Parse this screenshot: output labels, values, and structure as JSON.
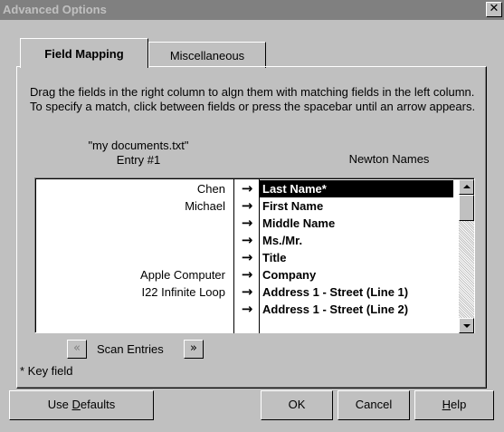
{
  "window": {
    "title": "Advanced Options",
    "close_glyph": "✕"
  },
  "tabs": [
    {
      "label": "Field Mapping",
      "active": true
    },
    {
      "label": "Miscellaneous",
      "active": false
    }
  ],
  "instructions": "Drag the fields in the right column to algn them with matching fields in the left column.  To specify a match, click between fields or press the spacebar until an arrow appears.",
  "source": {
    "file": "\"my documents.txt\"",
    "entry": "Entry #1"
  },
  "destination_header": "Newton Names",
  "arrow_glyph": "→",
  "rows": [
    {
      "source": "Chen",
      "dest": "Last Name*",
      "selected": true
    },
    {
      "source": "Michael",
      "dest": "First Name",
      "selected": false
    },
    {
      "source": "",
      "dest": "Middle Name",
      "selected": false
    },
    {
      "source": "",
      "dest": "Ms./Mr.",
      "selected": false
    },
    {
      "source": "",
      "dest": "Title",
      "selected": false
    },
    {
      "source": "Apple Computer",
      "dest": "Company",
      "selected": false
    },
    {
      "source": "I22 Infinite Loop",
      "dest": "Address 1 - Street (Line 1)",
      "selected": false
    },
    {
      "source": "",
      "dest": "Address 1 - Street (Line 2)",
      "selected": false
    }
  ],
  "scan": {
    "label": "Scan Entries",
    "prev_glyph": "«",
    "next_glyph": "»",
    "prev_enabled": false,
    "next_enabled": true
  },
  "key_note": "* Key field",
  "buttons": {
    "defaults": {
      "pre": "Use ",
      "mnemonic": "D",
      "post": "efaults"
    },
    "ok": "OK",
    "cancel": "Cancel",
    "help": {
      "pre": "",
      "mnemonic": "H",
      "post": "elp"
    }
  }
}
